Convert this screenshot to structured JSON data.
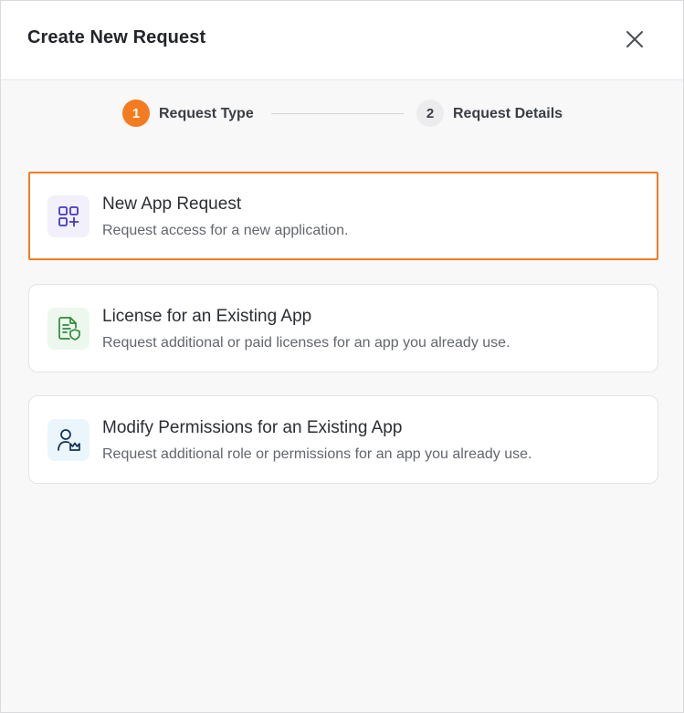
{
  "modal": {
    "title": "Create New Request",
    "close_icon": "close-icon"
  },
  "stepper": {
    "steps": [
      {
        "number": "1",
        "label": "Request Type",
        "active": true
      },
      {
        "number": "2",
        "label": "Request Details",
        "active": false
      }
    ]
  },
  "options": [
    {
      "title": "New App Request",
      "description": "Request access for a new application.",
      "icon": "apps-add-icon",
      "icon_color": "#4338ca",
      "icon_bg": "#f2f0fb",
      "selected": true
    },
    {
      "title": "License for an Existing App",
      "description": "Request additional or paid licenses for an app you already use.",
      "icon": "license-document-icon",
      "icon_color": "#2e8b3a",
      "icon_bg": "#ecf8ee",
      "selected": false
    },
    {
      "title": "Modify Permissions for an Existing App",
      "description": "Request additional role or permissions for an app you already use.",
      "icon": "user-permissions-icon",
      "icon_color": "#0f2f5a",
      "icon_bg": "#eaf6fb",
      "selected": false
    }
  ],
  "colors": {
    "accent": "#f47c20"
  }
}
